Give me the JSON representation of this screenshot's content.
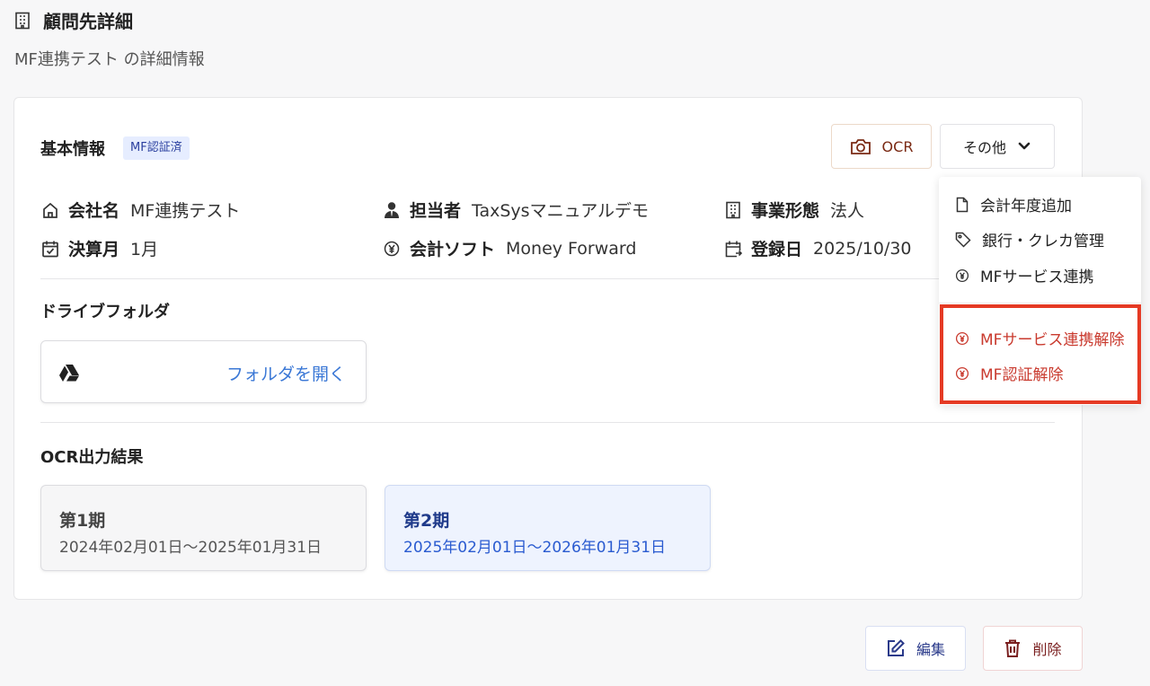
{
  "page": {
    "title": "顧問先詳細",
    "subtitle": "MF連携テスト の詳細情報"
  },
  "basic_info": {
    "heading": "基本情報",
    "badge": "MF認証済",
    "ocr_button": "OCR",
    "other_button": "その他",
    "fields": {
      "company": {
        "label": "会社名",
        "value": "MF連携テスト"
      },
      "manager": {
        "label": "担当者",
        "value": "TaxSysマニュアルデモ"
      },
      "business_type": {
        "label": "事業形態",
        "value": "法人"
      },
      "fiscal_month": {
        "label": "決算月",
        "value": "1月"
      },
      "accounting_software": {
        "label": "会計ソフト",
        "value": "Money Forward"
      },
      "registered_date": {
        "label": "登録日",
        "value": "2025/10/30"
      }
    }
  },
  "drive": {
    "heading": "ドライブフォルダ",
    "open_link": "フォルダを開く"
  },
  "ocr_results": {
    "heading": "OCR出力結果",
    "periods": [
      {
        "name": "第1期",
        "range": "2024年02月01日〜2025年01月31日"
      },
      {
        "name": "第2期",
        "range": "2025年02月01日〜2026年01月31日"
      }
    ]
  },
  "dropdown": {
    "items": [
      {
        "label": "会計年度追加",
        "icon": "file-icon"
      },
      {
        "label": "銀行・クレカ管理",
        "icon": "tag-icon"
      },
      {
        "label": "MFサービス連携",
        "icon": "yen-circle-icon"
      }
    ],
    "danger_items": [
      {
        "label": "MFサービス連携解除",
        "icon": "yen-circle-icon"
      },
      {
        "label": "MF認証解除",
        "icon": "yen-circle-icon"
      }
    ]
  },
  "footer": {
    "edit_button": "編集",
    "delete_button": "削除"
  },
  "colors": {
    "accent_blue": "#3b78d6",
    "danger_red": "#c93a2e",
    "highlight_red": "#e53a24",
    "badge_bg": "#e6edff"
  }
}
